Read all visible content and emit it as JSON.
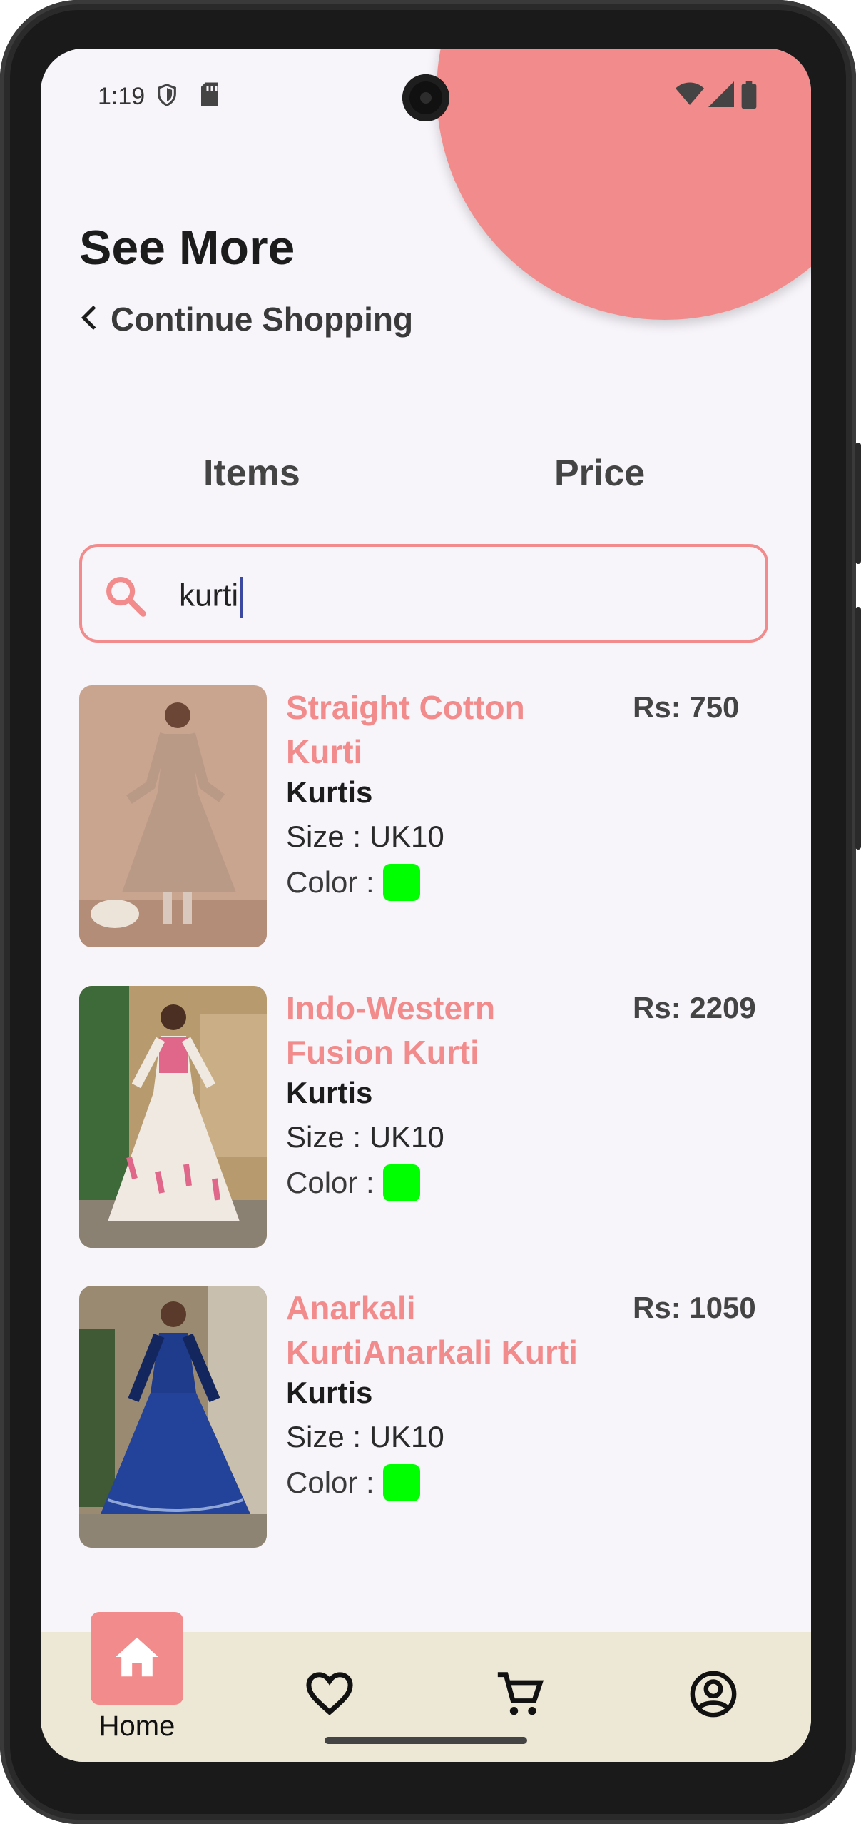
{
  "status_bar": {
    "time": "1:19",
    "left_icons": [
      "shield-icon",
      "sd-card-icon"
    ],
    "right_icons": [
      "wifi-icon",
      "signal-icon",
      "battery-icon"
    ]
  },
  "header": {
    "title": "See More",
    "back_label": "Continue Shopping"
  },
  "tabs": {
    "items": "Items",
    "price": "Price"
  },
  "search": {
    "value": "kurti",
    "icon": "search-icon"
  },
  "products": [
    {
      "name": "Straight Cotton Kurti",
      "price": "Rs: 750",
      "category": "Kurtis",
      "size": "Size : UK10",
      "color_label": "Color :",
      "color": "#00ff00",
      "image": {
        "bg": "#c9a48f",
        "dress": "#b99a86",
        "trim": "#8a6a58"
      }
    },
    {
      "name": "Indo-Western Fusion Kurti",
      "price": "Rs: 2209",
      "category": "Kurtis",
      "size": "Size : UK10",
      "color_label": "Color :",
      "color": "#00ff00",
      "image": {
        "bg": "#b79a6d",
        "dress": "#efe9e2",
        "trim": "#e0678a"
      }
    },
    {
      "name": "Anarkali KurtiAnarkali Kurti",
      "price": "Rs: 1050",
      "category": "Kurtis",
      "size": "Size : UK10",
      "color_label": "Color :",
      "color": "#00ff00",
      "image": {
        "bg": "#9a8a72",
        "dress": "#1f3b8c",
        "trim": "#13265e"
      }
    }
  ],
  "bottom_nav": {
    "home_label": "Home",
    "items": [
      "home-icon",
      "heart-icon",
      "cart-icon",
      "account-icon"
    ]
  },
  "colors": {
    "accent": "#f28b8b",
    "background": "#f7f4fa",
    "nav_bg": "#ede8d6",
    "swatch": "#00ff00"
  }
}
